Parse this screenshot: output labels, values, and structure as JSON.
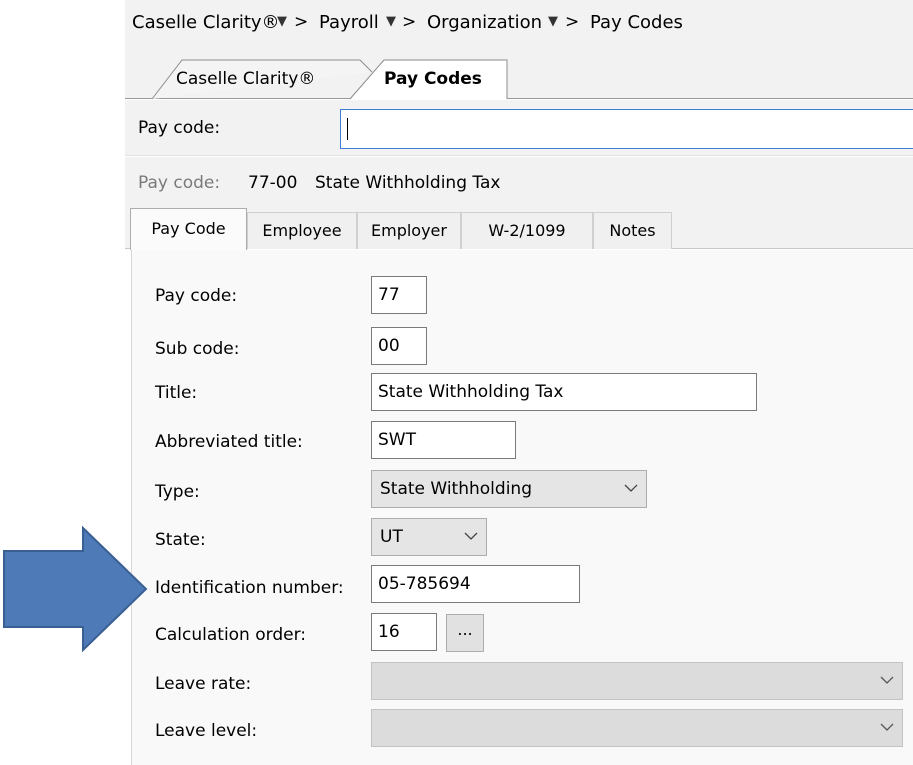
{
  "breadcrumb": {
    "items": [
      "Caselle Clarity®",
      "Payroll",
      "Organization",
      "Pay Codes"
    ],
    "separator": ">"
  },
  "doc_tabs": [
    {
      "label": "Caselle Clarity®",
      "active": false
    },
    {
      "label": "Pay Codes",
      "active": true
    }
  ],
  "search": {
    "label": "Pay code:",
    "value": ""
  },
  "current": {
    "label": "Pay code:",
    "code": "77-00",
    "title": "State Withholding Tax"
  },
  "sub_tabs": [
    {
      "label": "Pay Code",
      "active": true
    },
    {
      "label": "Employee",
      "active": false
    },
    {
      "label": "Employer",
      "active": false
    },
    {
      "label": "W-2/1099",
      "active": false
    },
    {
      "label": "Notes",
      "active": false
    }
  ],
  "form": {
    "pay_code": {
      "label": "Pay code:",
      "value": "77"
    },
    "sub_code": {
      "label": "Sub code:",
      "value": "00"
    },
    "title": {
      "label": "Title:",
      "value": "State Withholding Tax"
    },
    "abbreviated_title": {
      "label": "Abbreviated title:",
      "value": "SWT"
    },
    "type": {
      "label": "Type:",
      "value": "State Withholding"
    },
    "state": {
      "label": "State:",
      "value": "UT"
    },
    "identification_number": {
      "label": "Identification number:",
      "value": "05-785694"
    },
    "calculation_order": {
      "label": "Calculation order:",
      "value": "16",
      "button": "..."
    },
    "leave_rate": {
      "label": "Leave rate:",
      "value": ""
    },
    "leave_level": {
      "label": "Leave level:",
      "value": ""
    }
  },
  "annotation": {
    "shape": "arrow-right",
    "color": "#4e7ab8",
    "outline": "#3a5f92"
  }
}
